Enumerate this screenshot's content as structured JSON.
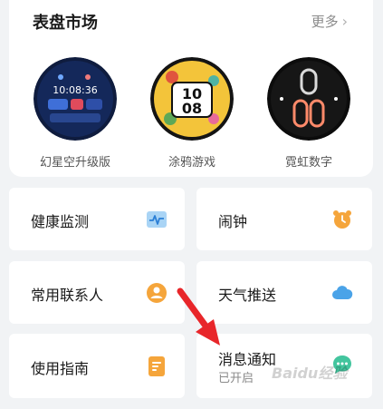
{
  "market": {
    "title": "表盘市场",
    "more_label": "更多",
    "watch_faces": [
      {
        "label": "幻星空升级版",
        "time": "10:08:36"
      },
      {
        "label": "涂鸦游戏",
        "time": "10 08"
      },
      {
        "label": "霓虹数字",
        "time": "10 08"
      }
    ]
  },
  "tiles": {
    "health": {
      "label": "健康监测",
      "icon": "heart-rate-icon"
    },
    "alarm": {
      "label": "闹钟",
      "icon": "alarm-clock-icon"
    },
    "contacts": {
      "label": "常用联系人",
      "icon": "person-icon"
    },
    "weather": {
      "label": "天气推送",
      "icon": "cloud-icon"
    },
    "guide": {
      "label": "使用指南",
      "icon": "document-icon"
    },
    "notifications": {
      "label": "消息通知",
      "status": "已开启",
      "icon": "chat-bubble-icon"
    }
  },
  "watermark": "Baidu经验",
  "colors": {
    "accent_orange": "#f5a53b",
    "accent_blue": "#4aa3e8",
    "arrow_red": "#e8262a"
  }
}
